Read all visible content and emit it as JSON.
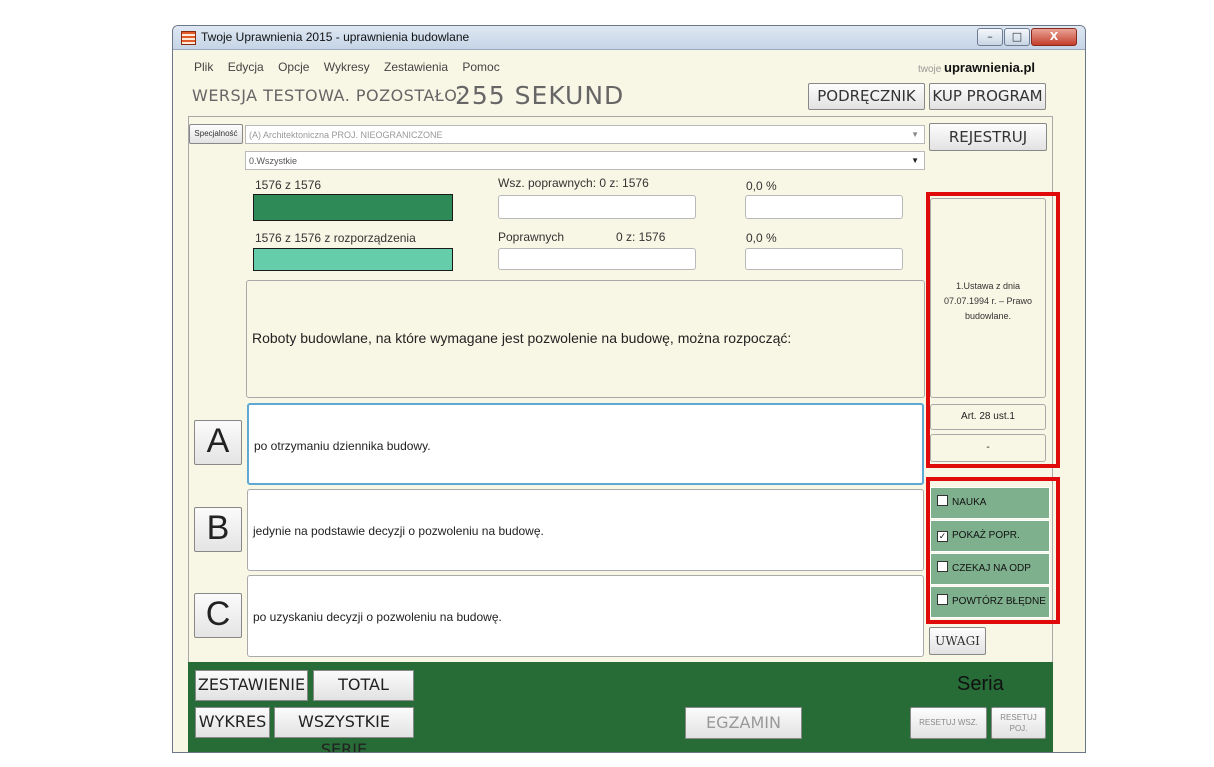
{
  "window": {
    "title": "Twoje Uprawnienia 2015 - uprawnienia budowlane",
    "minimize": "–",
    "maximize": "□",
    "close": "X"
  },
  "menu": [
    "Plik",
    "Edycja",
    "Opcje",
    "Wykresy",
    "Zestawienia",
    "Pomoc"
  ],
  "brand": {
    "prefix": "twoje",
    "name": "uprawnienia.pl"
  },
  "header": {
    "trial_label": "WERSJA TESTOWA. POZOSTAŁO:",
    "seconds": "255 SEKUND",
    "manual_button": "PODRĘCZNIK",
    "buy_button": "KUP PROGRAM",
    "register_button": "REJESTRUJ"
  },
  "filters": {
    "specialty_button": "Specjalność",
    "specialty_value": "(A) Architektoniczna  PROJ. NIEOGRANICZONE",
    "category_value": "0.Wszystkie"
  },
  "progress": {
    "total_label": "1576 z 1576",
    "total_fill": 1.0,
    "correct_all_label": "Wsz. poprawnych: 0 z: 1576",
    "correct_all_pct": "0,0 %",
    "regulation_label": "1576 z 1576 z rozporządzenia",
    "regulation_fill": 1.0,
    "correct_label": "Poprawnych",
    "correct_count": "0 z: 1576",
    "correct_pct": "0,0 %"
  },
  "question": {
    "text": "Roboty budowlane, na które wymagane jest pozwolenie na budowę, można rozpocząć:"
  },
  "source": {
    "law": "1.Ustawa z dnia 07.07.1994 r. – Prawo budowlane.",
    "article": "Art. 28 ust.1",
    "note": "-"
  },
  "answers": [
    {
      "letter": "A",
      "text": "po otrzymaniu dziennika budowy."
    },
    {
      "letter": "B",
      "text": "jedynie na podstawie decyzji o pozwoleniu na budowę."
    },
    {
      "letter": "C",
      "text": "po uzyskaniu decyzji o pozwoleniu na budowę."
    }
  ],
  "options": [
    {
      "label": "NAUKA",
      "checked": false
    },
    {
      "label": "POKAŻ POPR.",
      "checked": true
    },
    {
      "label": "CZEKAJ NA ODP",
      "checked": false
    },
    {
      "label": "POWTÓRZ BŁĘDNE",
      "checked": false
    }
  ],
  "check_mark": "✓",
  "remarks_button": "UWAGI",
  "bottom": {
    "summary": "ZESTAWIENIE",
    "total": "TOTAL",
    "chart": "WYKRES",
    "all_series": "WSZYSTKIE SERIE",
    "exam": "EGZAMIN",
    "series_title": "Seria",
    "reset_all": "RESETUJ WSZ.",
    "reset_single": "RESETUJ POJ."
  },
  "colors": {
    "bar_total": "#2e8b57",
    "bar_regulation": "#66cdaa",
    "green_panel": "#276b36",
    "highlight": "#e00a0a"
  }
}
